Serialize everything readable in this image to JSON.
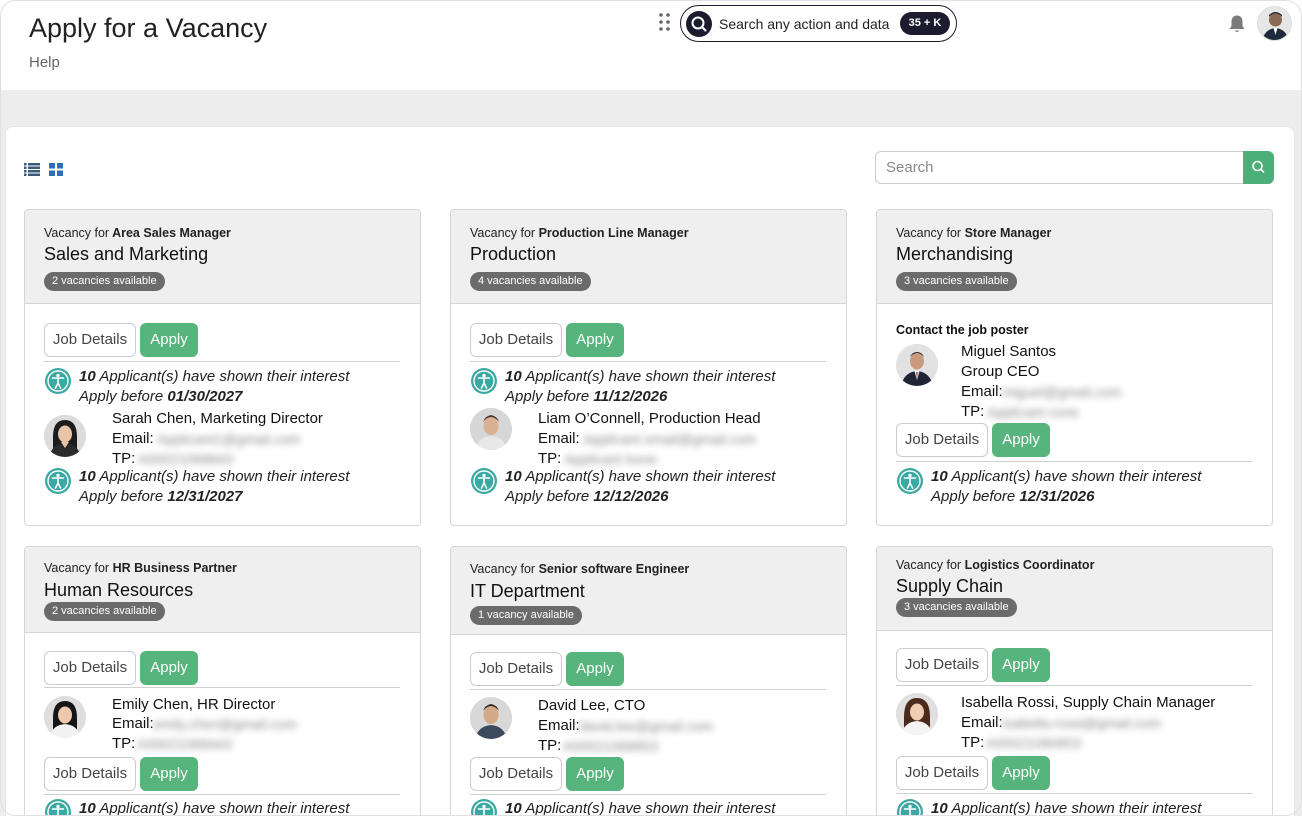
{
  "header": {
    "title": "Apply for a Vacancy",
    "help": "Help",
    "command_search": {
      "label": "Search any action and data",
      "shortcut": "35 + K"
    }
  },
  "toolbar": {
    "search_placeholder": "Search"
  },
  "labels": {
    "job_details": "Job Details",
    "apply": "Apply",
    "email": "Email:",
    "tp": "TP:",
    "contact_poster": "Contact the job poster",
    "vacancy_for": "Vacancy for",
    "interest_suffix": "Applicant(s) have shown their interest",
    "apply_before": "Apply before"
  },
  "cards": [
    {
      "role": "Area Sales Manager",
      "department": "Sales and Marketing",
      "badge": "2 vacancies available",
      "interest_1": "10",
      "deadline_1": "01/30/2027",
      "contact": {
        "name": "Sarah Chen, Marketing Director",
        "email": "Applicant1@gmail.com",
        "tp": "A00021068843"
      },
      "interest_2": "10",
      "deadline_2": "12/31/2027"
    },
    {
      "role": "Production Line Manager",
      "department": "Production",
      "badge": "4 vacancies available",
      "interest_1": "10",
      "deadline_1": "11/12/2026",
      "contact": {
        "name": "Liam O’Connell, Production Head",
        "email": "Applicant email@gmail.com",
        "tp": "Applicant hone"
      },
      "interest_2": "10",
      "deadline_2": "12/12/2026"
    },
    {
      "role": "Store Manager",
      "department": "Merchandising",
      "badge": "3 vacancies available",
      "contact": {
        "name": "Miguel Santos",
        "title": "Group CEO",
        "email": "miguel@gmail.com",
        "tp": "Applicant cone"
      },
      "interest_1": "10",
      "deadline_1": "12/31/2026"
    },
    {
      "role": "HR Business Partner",
      "department": "Human Resources",
      "badge": "2 vacancies available",
      "contact": {
        "name": "Emily Chen, HR Director",
        "email": "emily.chen@gmail.com",
        "tp": "A00021068443"
      },
      "interest_1": "10"
    },
    {
      "role": "Senior software Engineer",
      "department": "IT Department",
      "badge": "1 vacancy available",
      "contact": {
        "name": "David Lee, CTO",
        "email": "david.lee@gmail.com",
        "tp": "A00021068853"
      },
      "interest_1": "10"
    },
    {
      "role": "Logistics Coordinator",
      "department": "Supply Chain",
      "badge": "3 vacancies available",
      "contact": {
        "name": "Isabella Rossi, Supply Chain Manager",
        "email": "isabella.rossi@gmail.com",
        "tp": "A00021080853"
      },
      "interest_1": "10"
    }
  ]
}
